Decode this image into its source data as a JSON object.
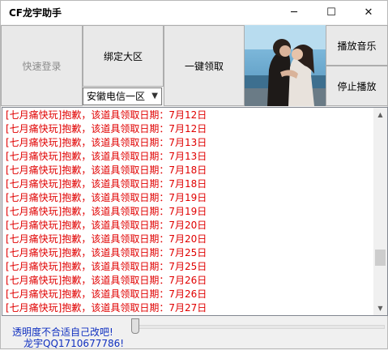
{
  "window": {
    "title": "CF龙宇助手",
    "controls": {
      "minimize": "─",
      "maximize": "☐",
      "close": "✕"
    }
  },
  "toolbar": {
    "quick_login_label": "快速登录",
    "bind_region_label": "绑定大区",
    "one_click_claim_label": "一键领取",
    "play_music_label": "播放音乐",
    "stop_playing_label": "停止播放",
    "region_select_value": "安徽电信一区"
  },
  "log": {
    "lines": [
      "[七月痛快玩]抱歉，该道具领取日期：7月12日",
      "[七月痛快玩]抱歉，该道具领取日期：7月12日",
      "[七月痛快玩]抱歉，该道具领取日期：7月13日",
      "[七月痛快玩]抱歉，该道具领取日期：7月13日",
      "[七月痛快玩]抱歉，该道具领取日期：7月18日",
      "[七月痛快玩]抱歉，该道具领取日期：7月18日",
      "[七月痛快玩]抱歉，该道具领取日期：7月19日",
      "[七月痛快玩]抱歉，该道具领取日期：7月19日",
      "[七月痛快玩]抱歉，该道具领取日期：7月20日",
      "[七月痛快玩]抱歉，该道具领取日期：7月20日",
      "[七月痛快玩]抱歉，该道具领取日期：7月25日",
      "[七月痛快玩]抱歉，该道具领取日期：7月25日",
      "[七月痛快玩]抱歉，该道具领取日期：7月26日",
      "[七月痛快玩]抱歉，该道具领取日期：7月26日",
      "[七月痛快玩]抱歉，该道具领取日期：7月27日"
    ],
    "text_color": "#e00000",
    "scroll_position": 0.78
  },
  "footer": {
    "transparency_hint": "透明度不合适自己改吧!",
    "contact": "龙宇QQ1710677786!",
    "slider_value": 0
  }
}
